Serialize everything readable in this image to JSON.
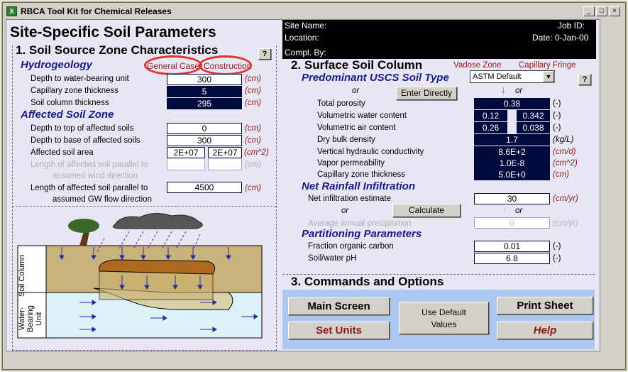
{
  "window": {
    "title": "RBCA Tool Kit for Chemical Releases",
    "icon": "X",
    "min": "_",
    "max": "□",
    "close": "×"
  },
  "page_title": "Site-Specific Soil Parameters",
  "site": {
    "site_name": "Site Name:",
    "job_id": "Job ID:",
    "location": "Location:",
    "date": "Date:  0-Jan-00",
    "compl_by": "Compl. By:"
  },
  "sec1": {
    "title": "1.  Soil Source Zone Characteristics",
    "help": "?",
    "hydro_title": "Hydrogeology",
    "general_case": "General Case",
    "construction": "Construction",
    "rows": [
      {
        "label": "Depth to water-bearing unit",
        "value": "300",
        "unit": "(cm)"
      },
      {
        "label": "Capillary zone thickness",
        "value": "5",
        "unit": "(cm)"
      },
      {
        "label": "Soil column thickness",
        "value": "295",
        "unit": "(cm)"
      }
    ],
    "affected_title": "Affected Soil Zone",
    "affected": [
      {
        "label": "Depth to top of affected soils",
        "value": "0",
        "unit": "(cm)"
      },
      {
        "label": "Depth to base of affected soils",
        "value": "300",
        "unit": "(cm)"
      }
    ],
    "area_label": "Affected soil area",
    "area_v1": "2E+07",
    "area_v2": "2E+07",
    "area_unit": "(cm^2)",
    "wind_label1": "Length of affected soil parallel to",
    "wind_label2": "assumed wind direction",
    "wind_unit": "(cm)",
    "gw_label1": "Length of affected soil parallel to",
    "gw_label2": "assumed GW flow direction",
    "gw_value": "4500",
    "gw_unit": "(cm)"
  },
  "diagram": {
    "soil_column": "Soil Column",
    "water_bearing": "Water-Bearing Unit"
  },
  "sec2": {
    "title": "2.  Surface Soil Column",
    "vadose": "Vadose Zone",
    "capillary": "Capillary Fringe",
    "uscs_title": "Predominant USCS Soil Type",
    "soil_type_value": "ASTM Default",
    "help": "?",
    "or": "or",
    "enter_directly": "Enter Directly",
    "props": [
      {
        "label": "Total porosity",
        "unit": "(-)"
      },
      {
        "label": "Volumetric water content",
        "unit": "(-)"
      },
      {
        "label": "Volumetric air content",
        "unit": "(-)"
      },
      {
        "label": "Dry bulk density",
        "unit": "(kg/L)"
      },
      {
        "label": "Vertical hydraulic conductivity",
        "unit": "(cm/d)"
      },
      {
        "label": "Vapor permeability",
        "unit": "(cm^2)"
      },
      {
        "label": "Capillary zone thickness",
        "unit": "(cm)"
      }
    ],
    "porosity": "0.38",
    "water_vadose": "0.12",
    "water_cap": "0.342",
    "air_vadose": "0.26",
    "air_cap": "0.038",
    "bulk_density": "1.7",
    "hydraulic_cond": "8.6E+2",
    "vapor_perm": "1.0E-8",
    "cap_thickness": "5.0E+0",
    "rain_title": "Net Rainfall Infiltration",
    "net_infil_label": "Net infiltration estimate",
    "net_infil_value": "30",
    "net_infil_unit": "(cm/yr)",
    "calculate": "Calculate",
    "precip_label": "Average annual precipitation",
    "precip_value": "0",
    "precip_unit": "(cm/yr)",
    "part_title": "Partitioning Parameters",
    "foc_label": "Fraction organic carbon",
    "foc_value": "0.01",
    "foc_unit": "(-)",
    "ph_label": "Soil/water pH",
    "ph_value": "6.8",
    "ph_unit": "(-)"
  },
  "sec3": {
    "title": "3.  Commands and Options",
    "main_screen": "Main Screen",
    "set_units": "Set Units",
    "use_default": "Use Default Values",
    "print_sheet": "Print Sheet",
    "help": "Help"
  },
  "colors": {
    "dark_field": "#000a3c",
    "label_blue": "#1a1a8c",
    "unit_red": "#8c1a1a",
    "cmd_panel": "#a8c8f0",
    "highlight_oval": "#e03030"
  }
}
